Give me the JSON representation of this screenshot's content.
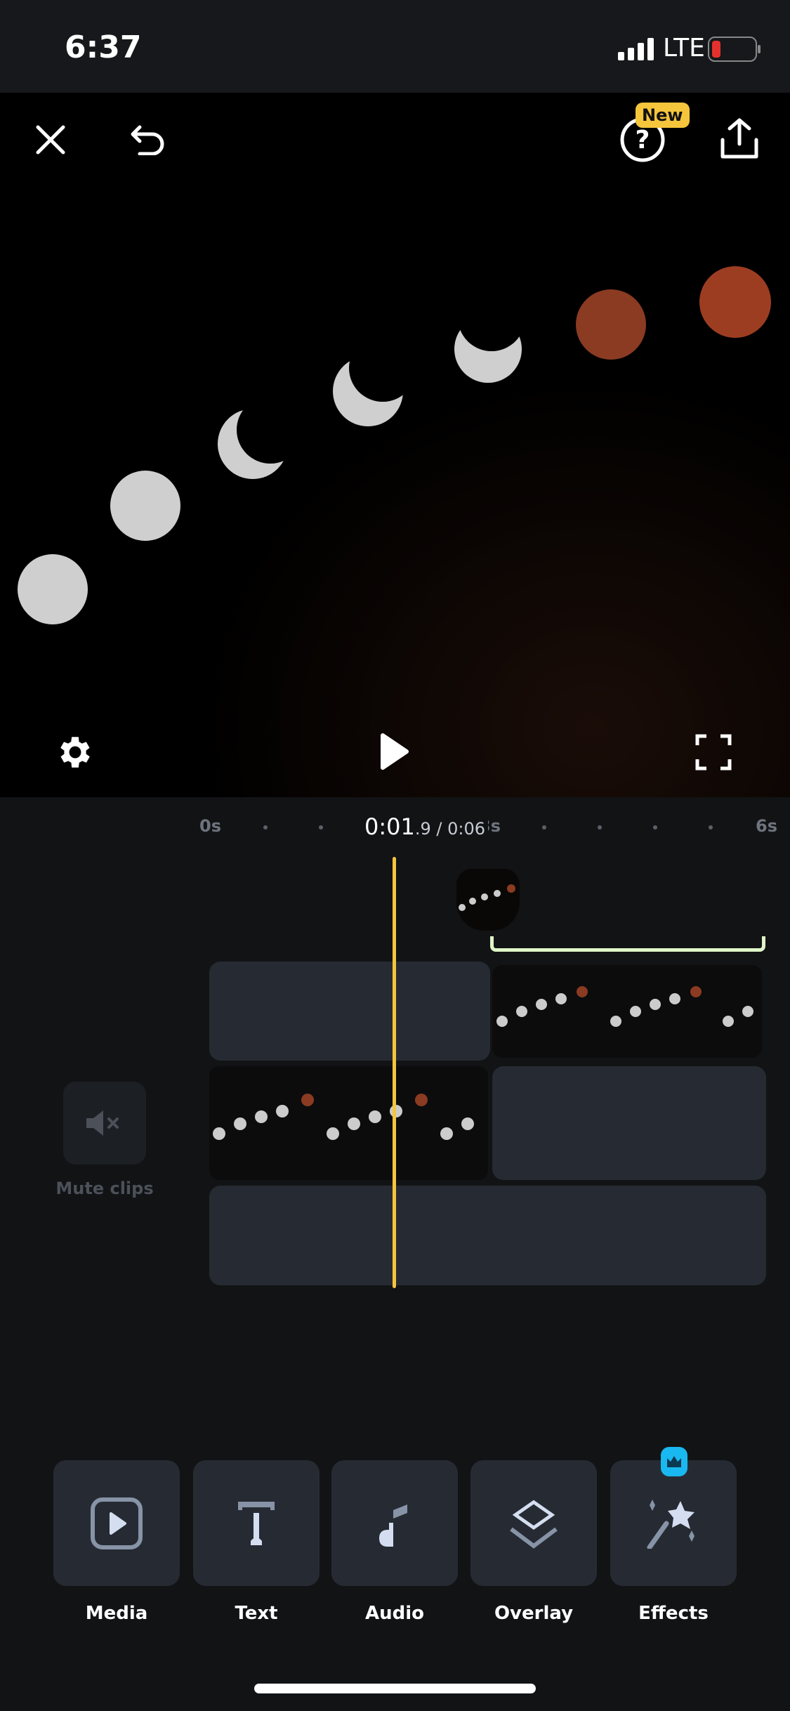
{
  "status": {
    "time": "6:37",
    "network": "LTE",
    "battery_level": "low"
  },
  "preview": {
    "new_badge": "New",
    "icons": [
      "close-icon",
      "undo-icon",
      "help-icon",
      "share-icon",
      "settings-icon",
      "play-icon",
      "fullscreen-icon"
    ]
  },
  "timeline": {
    "ticks": [
      "0s",
      "3s",
      "6s"
    ],
    "current_main": "0:01",
    "current_frac": ".9",
    "total": " / 0:06",
    "playhead_color": "#f5c53c",
    "selection_color": "#dff5c8"
  },
  "mute": {
    "label": "Mute clips"
  },
  "toolbar": [
    {
      "label": "Media",
      "icon": "media-play-icon"
    },
    {
      "label": "Text",
      "icon": "text-icon"
    },
    {
      "label": "Audio",
      "icon": "music-note-icon"
    },
    {
      "label": "Overlay",
      "icon": "layers-icon"
    },
    {
      "label": "Effects",
      "icon": "magic-wand-icon",
      "badge": "crown-icon"
    }
  ],
  "colors": {
    "accent": "#f5c53c",
    "premium": "#1ab8f0",
    "panel": "#262b33"
  }
}
